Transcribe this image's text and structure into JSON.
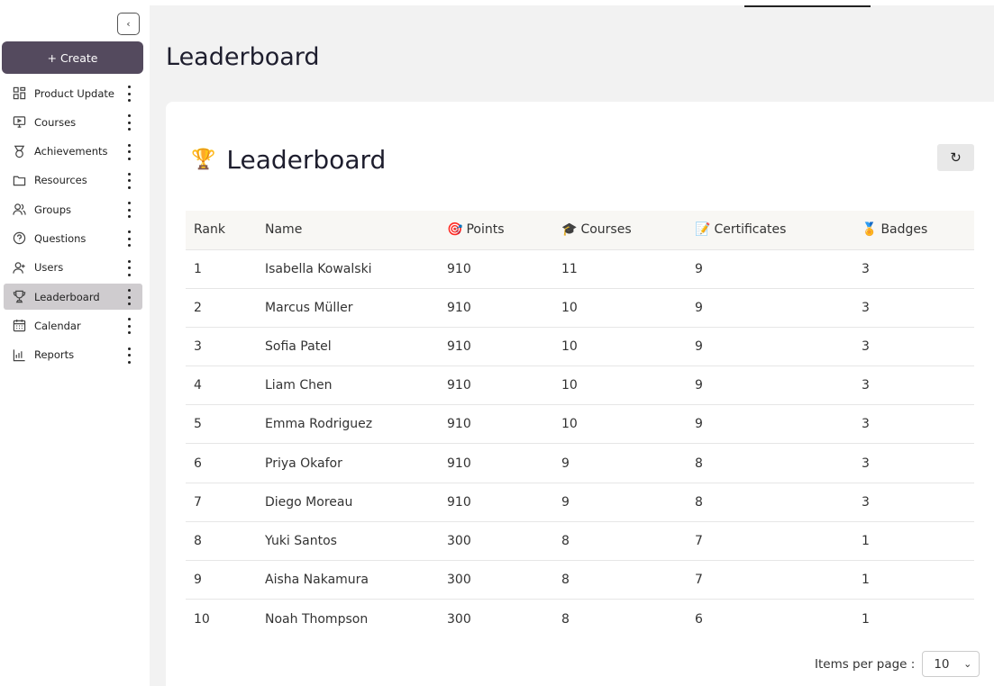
{
  "sidebar": {
    "create_label": "+ Create",
    "collapse_glyph": "‹",
    "items": [
      {
        "label": "Product Update",
        "icon": "grid-icon",
        "active": false
      },
      {
        "label": "Courses",
        "icon": "monitor-icon",
        "active": false
      },
      {
        "label": "Achievements",
        "icon": "medal-icon",
        "active": false
      },
      {
        "label": "Resources",
        "icon": "folder-icon",
        "active": false
      },
      {
        "label": "Groups",
        "icon": "users-group-icon",
        "active": false
      },
      {
        "label": "Questions",
        "icon": "question-circle-icon",
        "active": false
      },
      {
        "label": "Users",
        "icon": "user-plus-icon",
        "active": false
      },
      {
        "label": "Leaderboard",
        "icon": "trophy-icon",
        "active": true
      },
      {
        "label": "Calendar",
        "icon": "calendar-icon",
        "active": false
      },
      {
        "label": "Reports",
        "icon": "bar-chart-icon",
        "active": false
      }
    ]
  },
  "header": {
    "title": "Leaderboard"
  },
  "card": {
    "title": "Leaderboard",
    "trophy_glyph": "🏆",
    "refresh_glyph": "↻"
  },
  "table": {
    "columns": [
      {
        "label": "Rank",
        "icon": ""
      },
      {
        "label": "Name",
        "icon": ""
      },
      {
        "label": "Points",
        "icon": "🎯"
      },
      {
        "label": "Courses",
        "icon": "🎓"
      },
      {
        "label": "Certificates",
        "icon": "📝"
      },
      {
        "label": "Badges",
        "icon": "🏅"
      }
    ],
    "rows": [
      [
        "1",
        "Isabella Kowalski",
        "910",
        "11",
        "9",
        "3"
      ],
      [
        "2",
        "Marcus Müller",
        "910",
        "10",
        "9",
        "3"
      ],
      [
        "3",
        "Sofia Patel",
        "910",
        "10",
        "9",
        "3"
      ],
      [
        "4",
        "Liam Chen",
        "910",
        "10",
        "9",
        "3"
      ],
      [
        "5",
        "Emma Rodriguez",
        "910",
        "10",
        "9",
        "3"
      ],
      [
        "6",
        "Priya Okafor",
        "910",
        "9",
        "8",
        "3"
      ],
      [
        "7",
        "Diego Moreau",
        "910",
        "9",
        "8",
        "3"
      ],
      [
        "8",
        "Yuki Santos",
        "300",
        "8",
        "7",
        "1"
      ],
      [
        "9",
        "Aisha Nakamura",
        "300",
        "8",
        "7",
        "1"
      ],
      [
        "10",
        "Noah Thompson",
        "300",
        "8",
        "6",
        "1"
      ]
    ]
  },
  "pagination": {
    "label": "Items per page :",
    "selected": "10",
    "chevron": "⌄"
  },
  "colors": {
    "create_button": "#544a5e",
    "active_nav": "#cfcccf",
    "main_bg": "#f2f2f2"
  }
}
